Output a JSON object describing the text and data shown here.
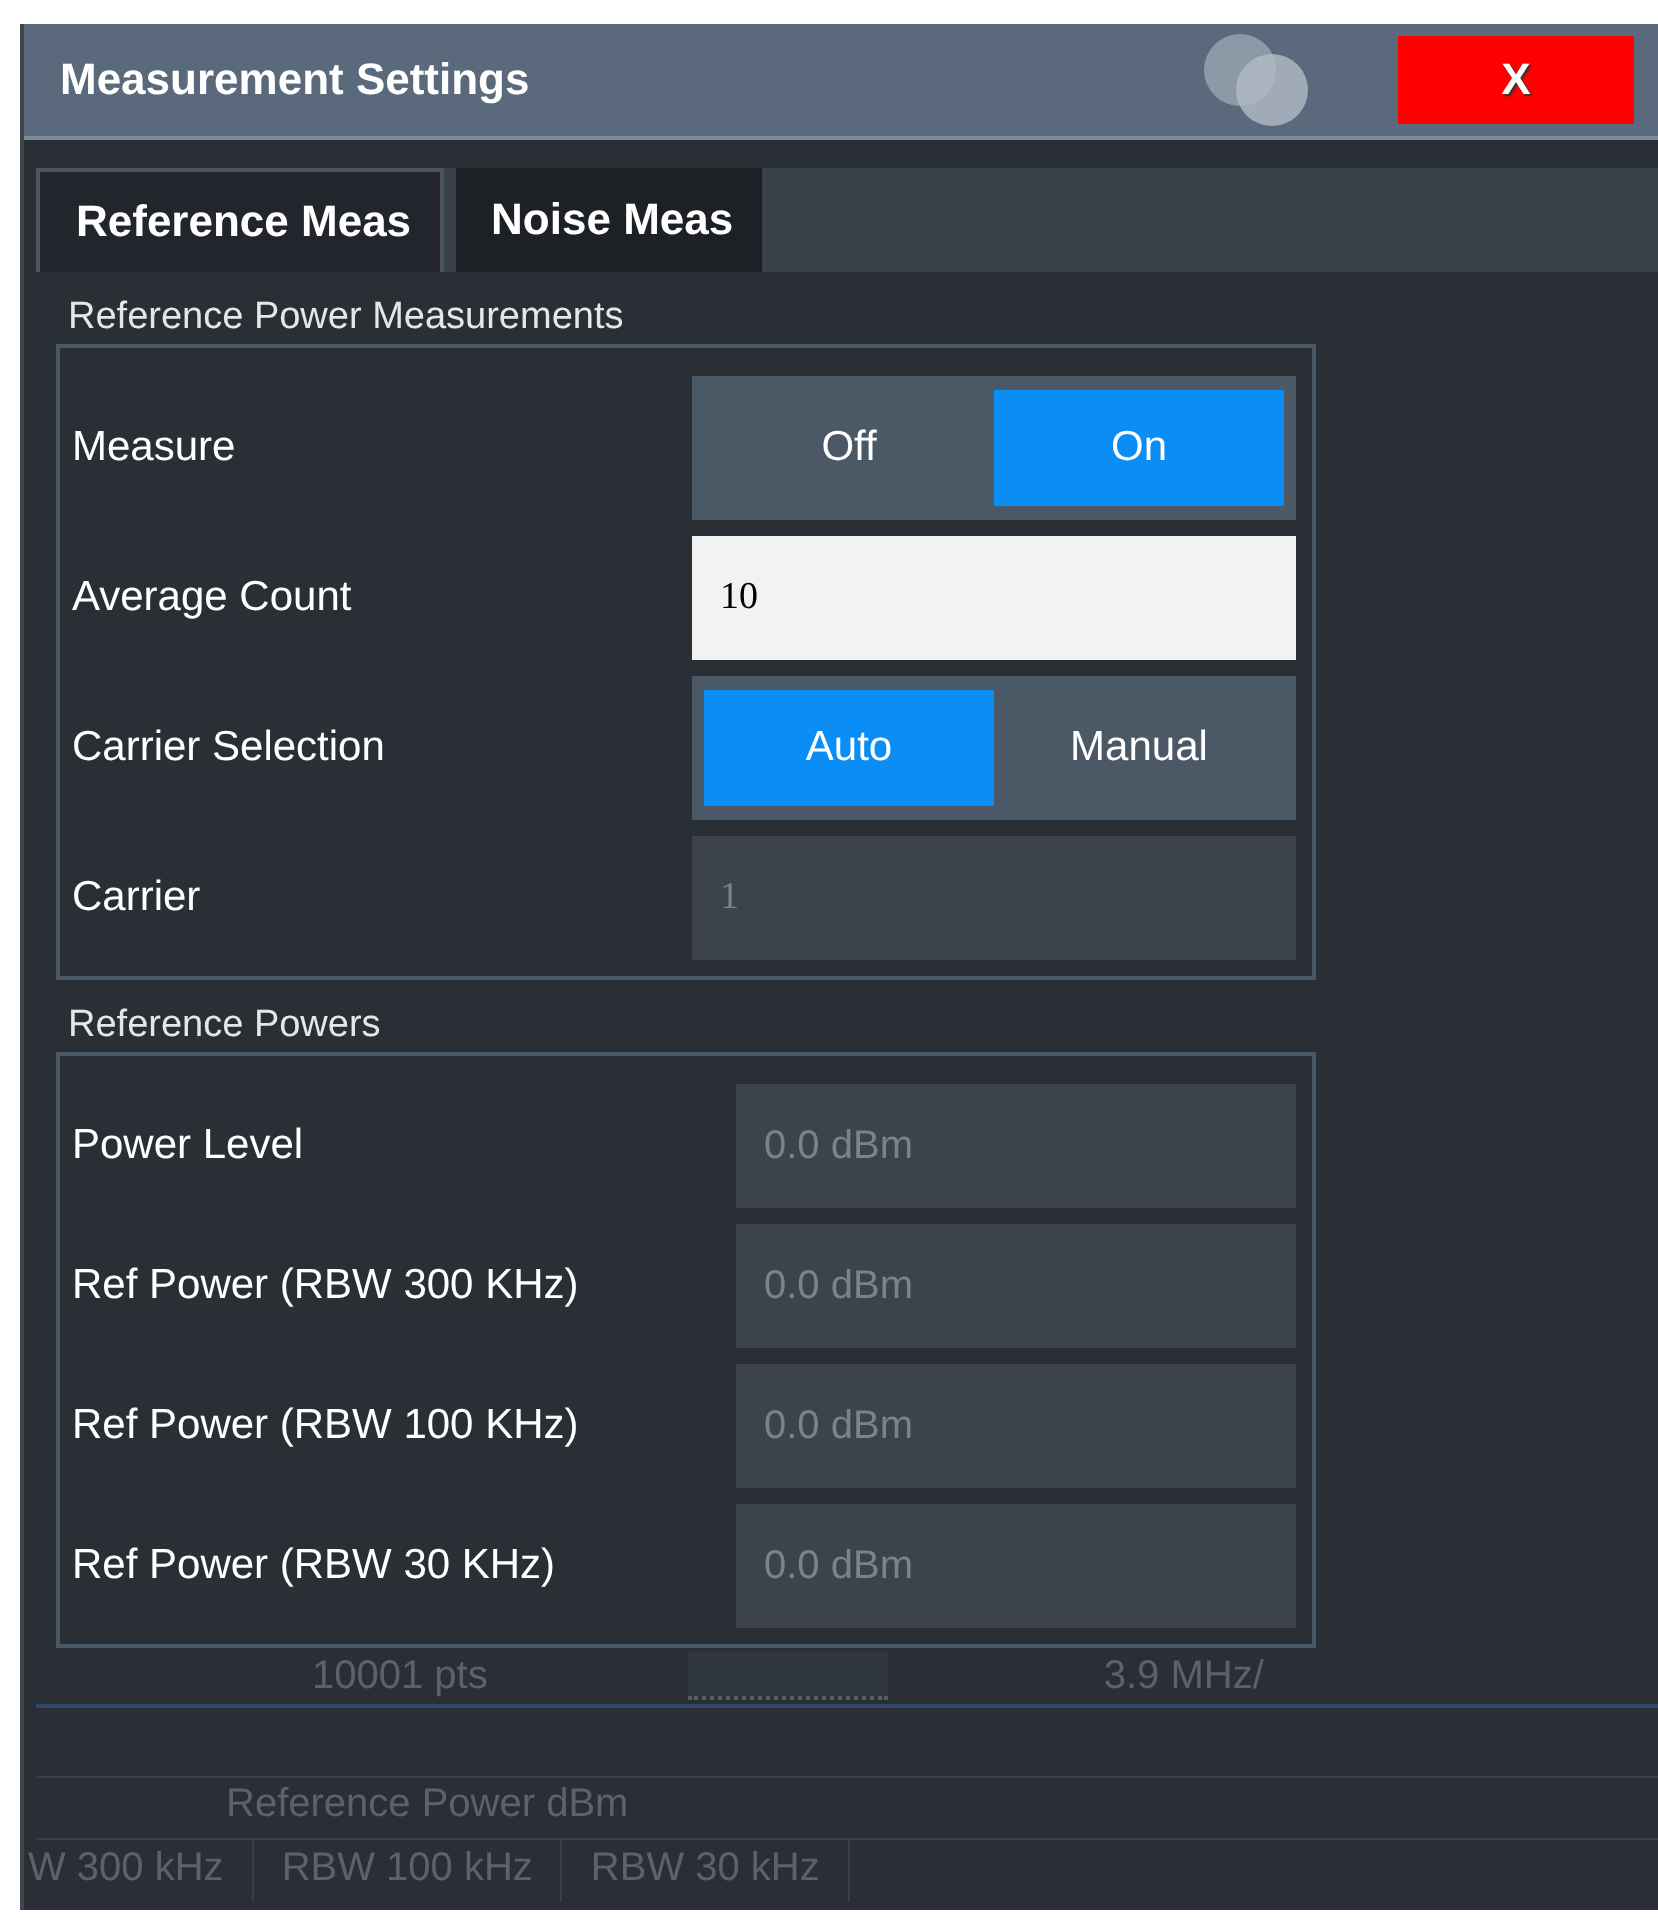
{
  "window": {
    "title": "Measurement Settings",
    "close_label": "X"
  },
  "tabs": [
    {
      "label": "Reference Meas",
      "selected": true
    },
    {
      "label": "Noise Meas",
      "selected": false
    }
  ],
  "sections": [
    {
      "title": "Reference Power Measurements",
      "rows": [
        {
          "kind": "toggle",
          "label": "Measure",
          "options": [
            {
              "label": "Off",
              "selected": false
            },
            {
              "label": "On",
              "selected": true
            }
          ]
        },
        {
          "kind": "field",
          "label": "Average Count",
          "value": "10",
          "disabled": false
        },
        {
          "kind": "toggle",
          "label": "Carrier Selection",
          "options": [
            {
              "label": "Auto",
              "selected": true
            },
            {
              "label": "Manual",
              "selected": false
            }
          ]
        },
        {
          "kind": "field",
          "label": "Carrier",
          "value": "1",
          "disabled": true
        }
      ]
    },
    {
      "title": "Reference Powers",
      "rows": [
        {
          "kind": "readout",
          "label": "Power Level",
          "value": "0.0 dBm",
          "disabled": true
        },
        {
          "kind": "readout",
          "label": "Ref Power (RBW 300 KHz)",
          "value": "0.0 dBm",
          "disabled": true
        },
        {
          "kind": "readout",
          "label": "Ref Power (RBW 100 KHz)",
          "value": "0.0 dBm",
          "disabled": true
        },
        {
          "kind": "readout",
          "label": "Ref Power (RBW 30 KHz)",
          "value": "0.0 dBm",
          "disabled": true
        }
      ]
    }
  ],
  "background": {
    "points": "10001 pts",
    "span_per_div": "3.9 MHz/",
    "table_title": "Reference Power dBm",
    "table_columns": [
      "W 300 kHz",
      "RBW 100 kHz",
      "RBW 30 kHz"
    ]
  }
}
